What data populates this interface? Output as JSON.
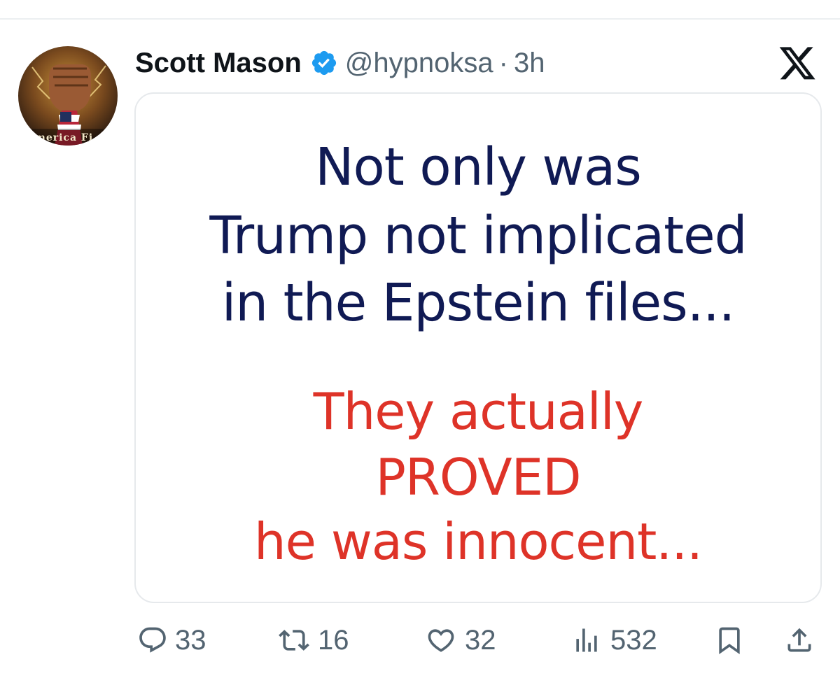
{
  "tweet": {
    "author": {
      "display_name": "Scott Mason",
      "handle": "@hypnoksa",
      "verified": true,
      "avatar_caption": "merica Fi"
    },
    "separator": "·",
    "time": "3h",
    "brand_icon": "x-logo-icon",
    "image": {
      "lines_blue": [
        "Not only was",
        "Trump not implicated",
        "in the Epstein files..."
      ],
      "lines_red": [
        "They actually",
        "PROVED",
        "he was innocent..."
      ]
    },
    "actions": {
      "replies": "33",
      "reposts": "16",
      "likes": "32",
      "views": "532"
    }
  },
  "colors": {
    "text_primary": "#0f1419",
    "text_secondary": "#536471",
    "verified_blue": "#1d9bf0",
    "meme_blue": "#101a54",
    "meme_red": "#de3328"
  }
}
